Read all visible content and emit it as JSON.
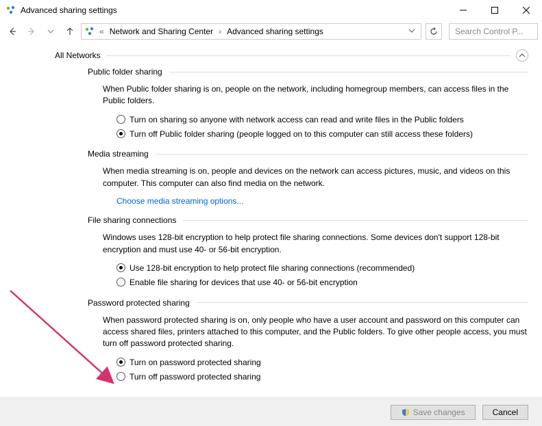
{
  "window": {
    "title": "Advanced sharing settings"
  },
  "breadcrumb": {
    "sep0": "«",
    "item1": "Network and Sharing Center",
    "sep1": "›",
    "item2": "Advanced sharing settings"
  },
  "search": {
    "placeholder": "Search Control P..."
  },
  "section": {
    "label": "All Networks"
  },
  "public_folder": {
    "header": "Public folder sharing",
    "desc": "When Public folder sharing is on, people on the network, including homegroup members, can access files in the Public folders.",
    "opt_on": "Turn on sharing so anyone with network access can read and write files in the Public folders",
    "opt_off": "Turn off Public folder sharing (people logged on to this computer can still access these folders)"
  },
  "media": {
    "header": "Media streaming",
    "desc": "When media streaming is on, people and devices on the network can access pictures, music, and videos on this computer. This computer can also find media on the network.",
    "link": "Choose media streaming options..."
  },
  "encryption": {
    "header": "File sharing connections",
    "desc": "Windows uses 128-bit encryption to help protect file sharing connections. Some devices don't support 128-bit encryption and must use 40- or 56-bit encryption.",
    "opt_128": "Use 128-bit encryption to help protect file sharing connections (recommended)",
    "opt_4056": "Enable file sharing for devices that use 40- or 56-bit encryption"
  },
  "password": {
    "header": "Password protected sharing",
    "desc": "When password protected sharing is on, only people who have a user account and password on this computer can access shared files, printers attached to this computer, and the Public folders. To give other people access, you must turn off password protected sharing.",
    "opt_on": "Turn on password protected sharing",
    "opt_off": "Turn off password protected sharing"
  },
  "footer": {
    "save": "Save changes",
    "cancel": "Cancel"
  }
}
